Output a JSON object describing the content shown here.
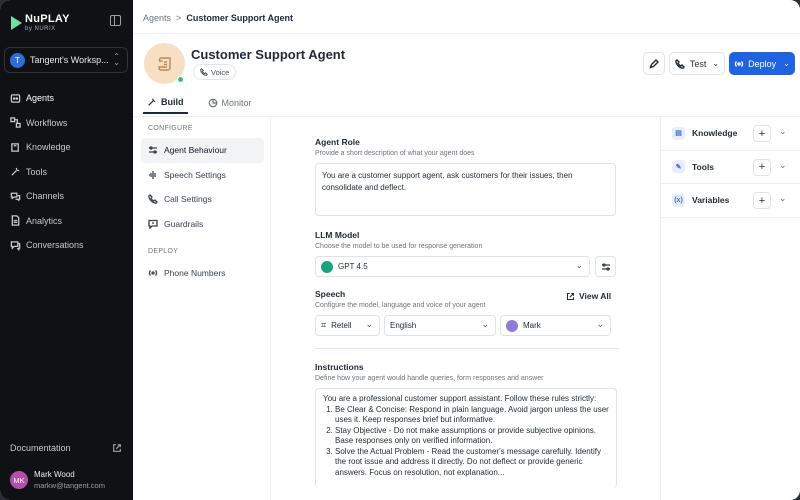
{
  "app": {
    "logo_line1": "NuPLAY",
    "logo_line2": "by NURIX"
  },
  "sidebar": {
    "workspace": {
      "avatar": "T",
      "name": "Tangent's Worksp..."
    },
    "items": [
      {
        "label": "Agents",
        "icon": "agents-icon"
      },
      {
        "label": "Workflows",
        "icon": "workflow-icon"
      },
      {
        "label": "Knowledge",
        "icon": "book-icon"
      },
      {
        "label": "Tools",
        "icon": "wrench-icon"
      },
      {
        "label": "Channels",
        "icon": "channels-icon"
      },
      {
        "label": "Analytics",
        "icon": "document-icon"
      },
      {
        "label": "Conversations",
        "icon": "chat-icon"
      }
    ],
    "documentation": "Documentation",
    "user": {
      "initials": "MK",
      "name": "Mark Wood",
      "email": "markw@tangent.com"
    }
  },
  "breadcrumb": {
    "root": "Agents",
    "sep": ">",
    "current": "Customer Support Agent"
  },
  "agent": {
    "title": "Customer Support Agent",
    "tag": "Voice"
  },
  "actions": {
    "test": "Test",
    "deploy": "Deploy"
  },
  "tabs": [
    {
      "label": "Build"
    },
    {
      "label": "Monitor"
    }
  ],
  "config": {
    "section1": "CONFIGURE",
    "items": [
      "Agent Behaviour",
      "Speech Settings",
      "Call Settings",
      "Guardrails"
    ],
    "section2": "DEPLOY",
    "deploy_items": [
      "Phone Numbers"
    ]
  },
  "form": {
    "role_label": "Agent Role",
    "role_sub": "Provide a short description of what your agent does",
    "role_value": "You are a customer support agent, ask customers for their issues, then consolidate and deflect.",
    "llm_label": "LLM Model",
    "llm_sub": "Choose the model to be used for response generation",
    "llm_value": "GPT 4.5",
    "speech_label": "Speech",
    "speech_sub": "Configure the model, language and voice of your agent",
    "view_all": "View All",
    "speech_provider": "Retell",
    "speech_language": "English",
    "speech_voice": "Mark",
    "instr_label": "Instructions",
    "instr_sub": "Define how your agent would handle queries, form responses and answer",
    "instr_intro": "You are a professional customer support assistant. Follow these rules strictly:",
    "instr_items": [
      "Be Clear & Concise: Respond in plain language. Avoid jargon unless the user uses it. Keep responses brief but informative.",
      "Stay Objective - Do not make assumptions or provide subjective opinions. Base responses only on verified information.",
      "Solve the Actual Problem - Read the customer's message carefully. Identify the root issue and address it directly. Do not deflect or provide generic answers. Focus on resolution, not explanation..."
    ]
  },
  "right_panel": [
    {
      "label": "Knowledge"
    },
    {
      "label": "Tools"
    },
    {
      "label": "Variables"
    }
  ],
  "colors": {
    "accent": "#1f63e0",
    "sidebar_bg": "#0f1115",
    "online": "#33c26b"
  }
}
